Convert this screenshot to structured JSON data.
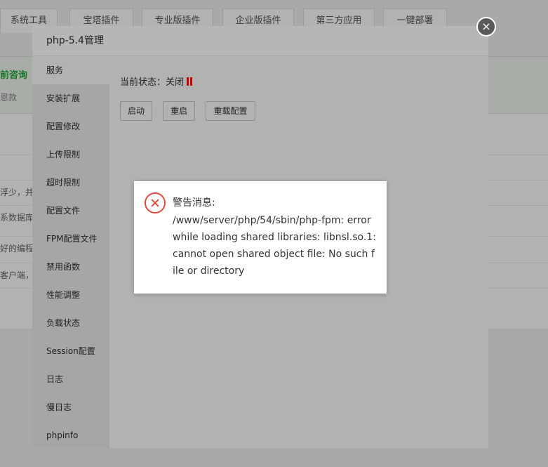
{
  "background": {
    "tabs": [
      "系统工具",
      "宝塔插件",
      "专业版插件",
      "企业版插件",
      "第三方应用",
      "一键部署"
    ],
    "green_text": "前咨询",
    "small_text": "恩款",
    "rows": [
      "浮少，并发",
      "系数据库",
      "好的编程语",
      "客户端，仅"
    ]
  },
  "dialog": {
    "title": "php-5.4管理",
    "close_label": "×",
    "sidebar": [
      {
        "label": "服务"
      },
      {
        "label": "安装扩展"
      },
      {
        "label": "配置修改"
      },
      {
        "label": "上传限制"
      },
      {
        "label": "超时限制"
      },
      {
        "label": "配置文件"
      },
      {
        "label": "FPM配置文件"
      },
      {
        "label": "禁用函数"
      },
      {
        "label": "性能调整"
      },
      {
        "label": "负载状态"
      },
      {
        "label": "Session配置"
      },
      {
        "label": "日志"
      },
      {
        "label": "慢日志"
      },
      {
        "label": "phpinfo"
      }
    ],
    "status_label": "当前状态：",
    "status_value": "关闭",
    "buttons": {
      "start": "启动",
      "restart": "重启",
      "reload": "重载配置"
    }
  },
  "alert": {
    "title": "警告消息:",
    "message": "/www/server/php/54/sbin/php-fpm: error while loading shared libraries: libnsl.so.1: cannot open shared object file: No such file or directory"
  },
  "colors": {
    "success_green": "#20a53a",
    "status_red": "#cc0000",
    "error_red": "#e04a3f"
  }
}
